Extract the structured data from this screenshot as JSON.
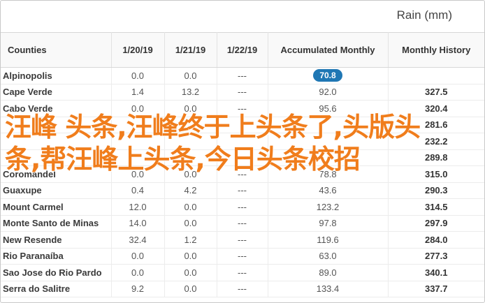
{
  "header": {
    "title": "Rain (mm)"
  },
  "table": {
    "columns": [
      "Counties",
      "1/20/19",
      "1/21/19",
      "1/22/19",
      "Accumulated Monthly",
      "Monthly History"
    ],
    "rows": [
      {
        "city": "Alpinopolis",
        "d1": "0.0",
        "d2": "0.0",
        "d3": "---",
        "acc": "70.8",
        "hist": "",
        "highlight": true
      },
      {
        "city": "Cape Verde",
        "d1": "1.4",
        "d2": "13.2",
        "d3": "---",
        "acc": "92.0",
        "hist": "327.5"
      },
      {
        "city": "Cabo Verde",
        "d1": "0.0",
        "d2": "0.0",
        "d3": "---",
        "acc": "95.6",
        "hist": "320.4"
      },
      {
        "city": "",
        "d1": "",
        "d2": "",
        "d3": "",
        "acc": "",
        "hist": "281.6"
      },
      {
        "city": "",
        "d1": "",
        "d2": "",
        "d3": "",
        "acc": "",
        "hist": "232.2"
      },
      {
        "city": "",
        "d1": "",
        "d2": "",
        "d3": "",
        "acc": "",
        "hist": "289.8"
      },
      {
        "city": "Coromandel",
        "d1": "0.0",
        "d2": "0.0",
        "d3": "---",
        "acc": "78.8",
        "hist": "315.0"
      },
      {
        "city": "Guaxupe",
        "d1": "0.4",
        "d2": "4.2",
        "d3": "---",
        "acc": "43.6",
        "hist": "290.3"
      },
      {
        "city": "Mount Carmel",
        "d1": "12.0",
        "d2": "0.0",
        "d3": "---",
        "acc": "123.2",
        "hist": "314.5"
      },
      {
        "city": "Monte Santo de Minas",
        "d1": "14.0",
        "d2": "0.0",
        "d3": "---",
        "acc": "97.8",
        "hist": "297.9"
      },
      {
        "city": "New Resende",
        "d1": "32.4",
        "d2": "1.2",
        "d3": "---",
        "acc": "119.6",
        "hist": "284.0"
      },
      {
        "city": "Rio Paranaíba",
        "d1": "0.0",
        "d2": "0.0",
        "d3": "---",
        "acc": "63.0",
        "hist": "277.3"
      },
      {
        "city": "Sao Jose do Rio Pardo",
        "d1": "0.0",
        "d2": "0.0",
        "d3": "---",
        "acc": "89.0",
        "hist": "340.1"
      },
      {
        "city": "Serra do Salitre",
        "d1": "9.2",
        "d2": "0.0",
        "d3": "---",
        "acc": "133.4",
        "hist": "337.7"
      }
    ]
  },
  "overlay": {
    "text": "汪峰 头条,汪峰终于上头条了,头版头条,帮汪峰上头条,今日头条校招"
  },
  "colors": {
    "badge": "#1f77b4",
    "overlay": "#f07d1c"
  }
}
